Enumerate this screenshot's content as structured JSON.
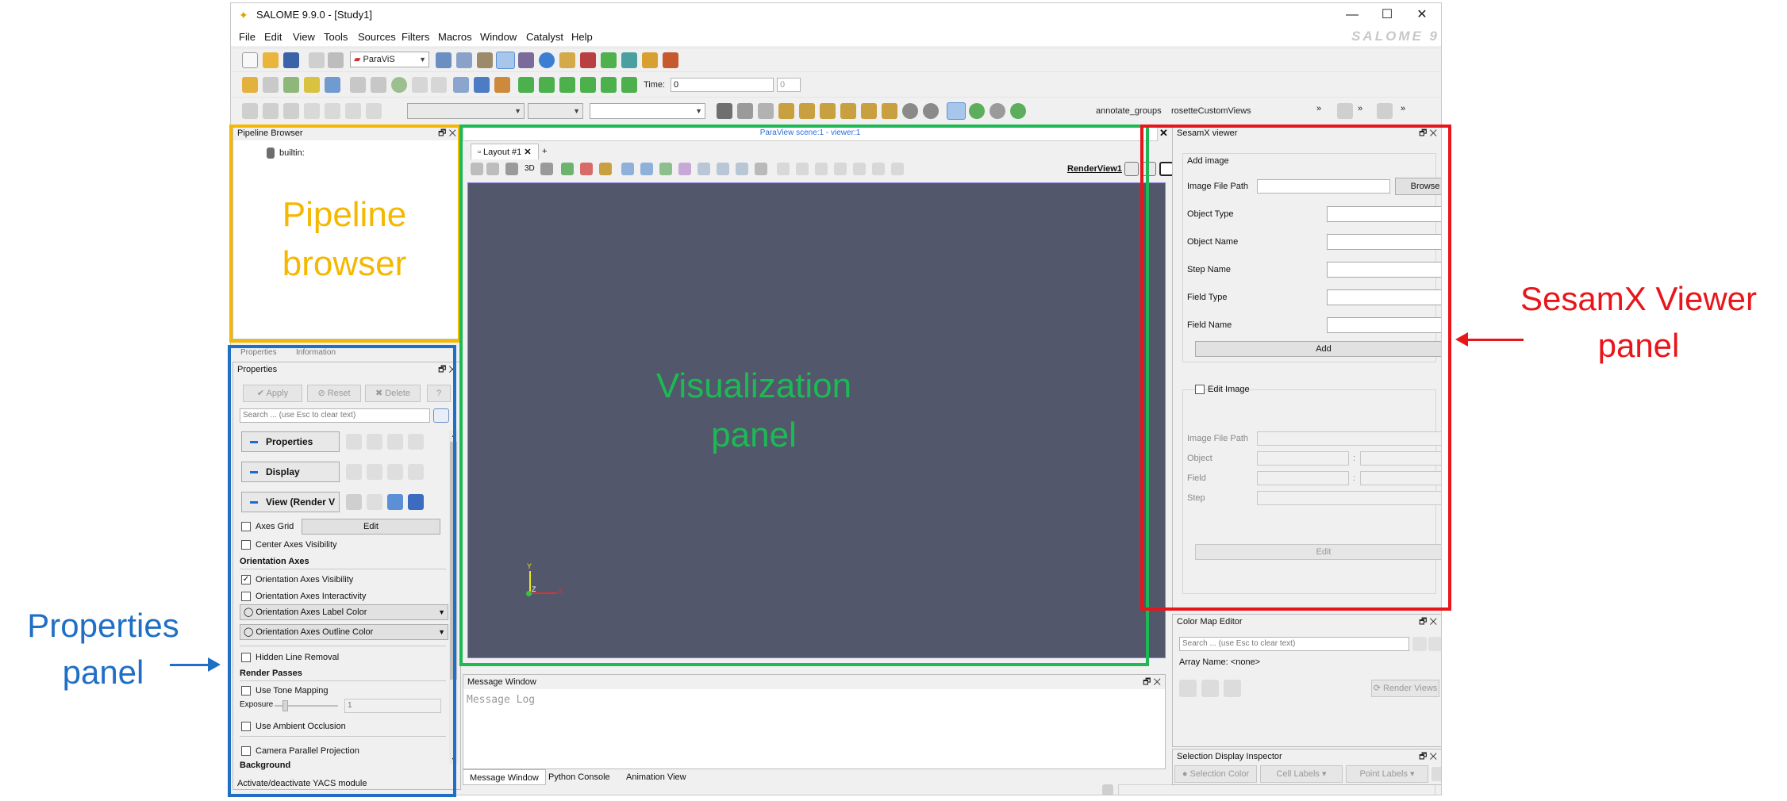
{
  "window": {
    "icon": "salome-logo-icon",
    "title": "SALOME 9.9.0 - [Study1]",
    "brand": "SALOME 9"
  },
  "menu": [
    "File",
    "Edit",
    "View",
    "Tools",
    "Sources",
    "Filters",
    "Macros",
    "Window",
    "Catalyst",
    "Help"
  ],
  "toolbar": {
    "module_combo": "ParaViS",
    "time_label": "Time:",
    "time_value": "0",
    "time_step": "0",
    "annotate_label": "annotate_groups",
    "rosette_label": "rosetteCustomViews"
  },
  "pipeline": {
    "title": "Pipeline Browser",
    "item": "builtin:"
  },
  "props_tabs": [
    "Properties",
    "Information"
  ],
  "properties": {
    "title": "Properties",
    "apply": "Apply",
    "reset": "Reset",
    "delete": "Delete",
    "help": "?",
    "search_placeholder": "Search ... (use Esc to clear text)",
    "sec_properties": "Properties",
    "sec_display": "Display",
    "sec_view": "View (Render V",
    "axes_grid": "Axes Grid",
    "edit": "Edit",
    "center_axes": "Center Axes Visibility",
    "orientation_axes": "Orientation Axes",
    "oa_visibility": "Orientation Axes Visibility",
    "oa_interactivity": "Orientation Axes Interactivity",
    "oa_label_color": "Orientation Axes Label Color",
    "oa_outline_color": "Orientation Axes Outline Color",
    "hidden_line": "Hidden Line Removal",
    "render_passes": "Render Passes",
    "tone_mapping": "Use Tone Mapping",
    "exposure": "Exposure",
    "exposure_value": "1",
    "ambient": "Use Ambient Occlusion",
    "camera_parallel": "Camera Parallel Projection",
    "background": "Background",
    "status": "Activate/deactivate YACS module"
  },
  "view": {
    "caption": "ParaView scene:1 - viewer:1",
    "layout_tab": "Layout #1",
    "add_tab": "+",
    "mode_3d": "3D",
    "render_view": "RenderView1",
    "axis_y": "Y",
    "axis_z": "Z",
    "axis_x": "X",
    "bg_color": "#52576b"
  },
  "message": {
    "title": "Message Window",
    "log": "Message Log",
    "tabs": [
      "Message Window",
      "Python Console",
      "Animation View"
    ]
  },
  "sesamx": {
    "title": "SesamX viewer",
    "add_image": "Add image",
    "image_path": "Image File Path",
    "browse": "Browse",
    "object_type": "Object Type",
    "object_name": "Object Name",
    "step_name": "Step Name",
    "field_type": "Field Type",
    "field_name": "Field Name",
    "add": "Add",
    "edit_image": "Edit Image",
    "e_image_path": "Image File Path",
    "e_object": "Object",
    "e_field": "Field",
    "e_step": "Step",
    "colon": ":",
    "edit": "Edit"
  },
  "colormap": {
    "title": "Color Map Editor",
    "search_placeholder": "Search ... (use Esc to clear text)",
    "array": "Array Name: <none>",
    "render_views": "Render Views"
  },
  "selection": {
    "title": "Selection Display Inspector",
    "sel_color": "Selection Color",
    "cell_labels": "Cell Labels",
    "point_labels": "Point Labels"
  },
  "annotations": {
    "pipeline": "Pipeline browser",
    "visualization": "Visualization panel",
    "properties": "Properties panel",
    "sesamx": "SesamX Viewer panel",
    "colors": {
      "pipeline": "#f5b800",
      "visualization": "#1db954",
      "properties": "#1f6fc5",
      "sesamx": "#e8161b"
    }
  }
}
